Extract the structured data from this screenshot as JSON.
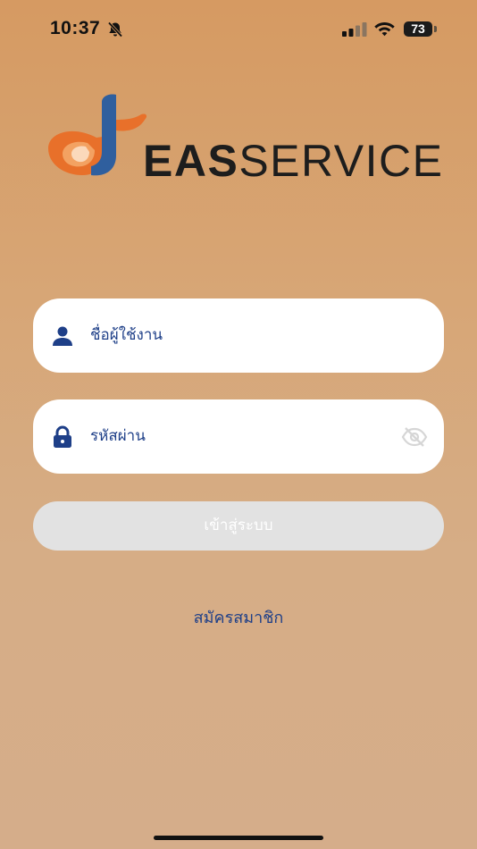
{
  "status_bar": {
    "time": "10:37",
    "battery_percent": 73,
    "battery_label": "73",
    "silent_mode": true,
    "signal_bars_active": 2
  },
  "logo": {
    "text_bold": "EAS",
    "text_light": "SERVICE",
    "colors": {
      "orange": "#e8702a",
      "blue": "#2f5f9e",
      "text": "#1d1d1d"
    }
  },
  "form": {
    "username": {
      "placeholder": "ชื่อผู้ใช้งาน",
      "value": "",
      "icon": "user-icon"
    },
    "password": {
      "placeholder": "รหัสผ่าน",
      "value": "",
      "icon": "lock-icon",
      "toggle_icon": "eye-off-icon"
    },
    "login_label": "เข้าสู่ระบบ",
    "register_label": "สมัครสมาชิก"
  },
  "colors": {
    "accent_blue": "#1e3f88",
    "button_disabled": "#e2e2e2",
    "background_top": "#d69a62",
    "background_bottom": "#d5ad8a"
  }
}
